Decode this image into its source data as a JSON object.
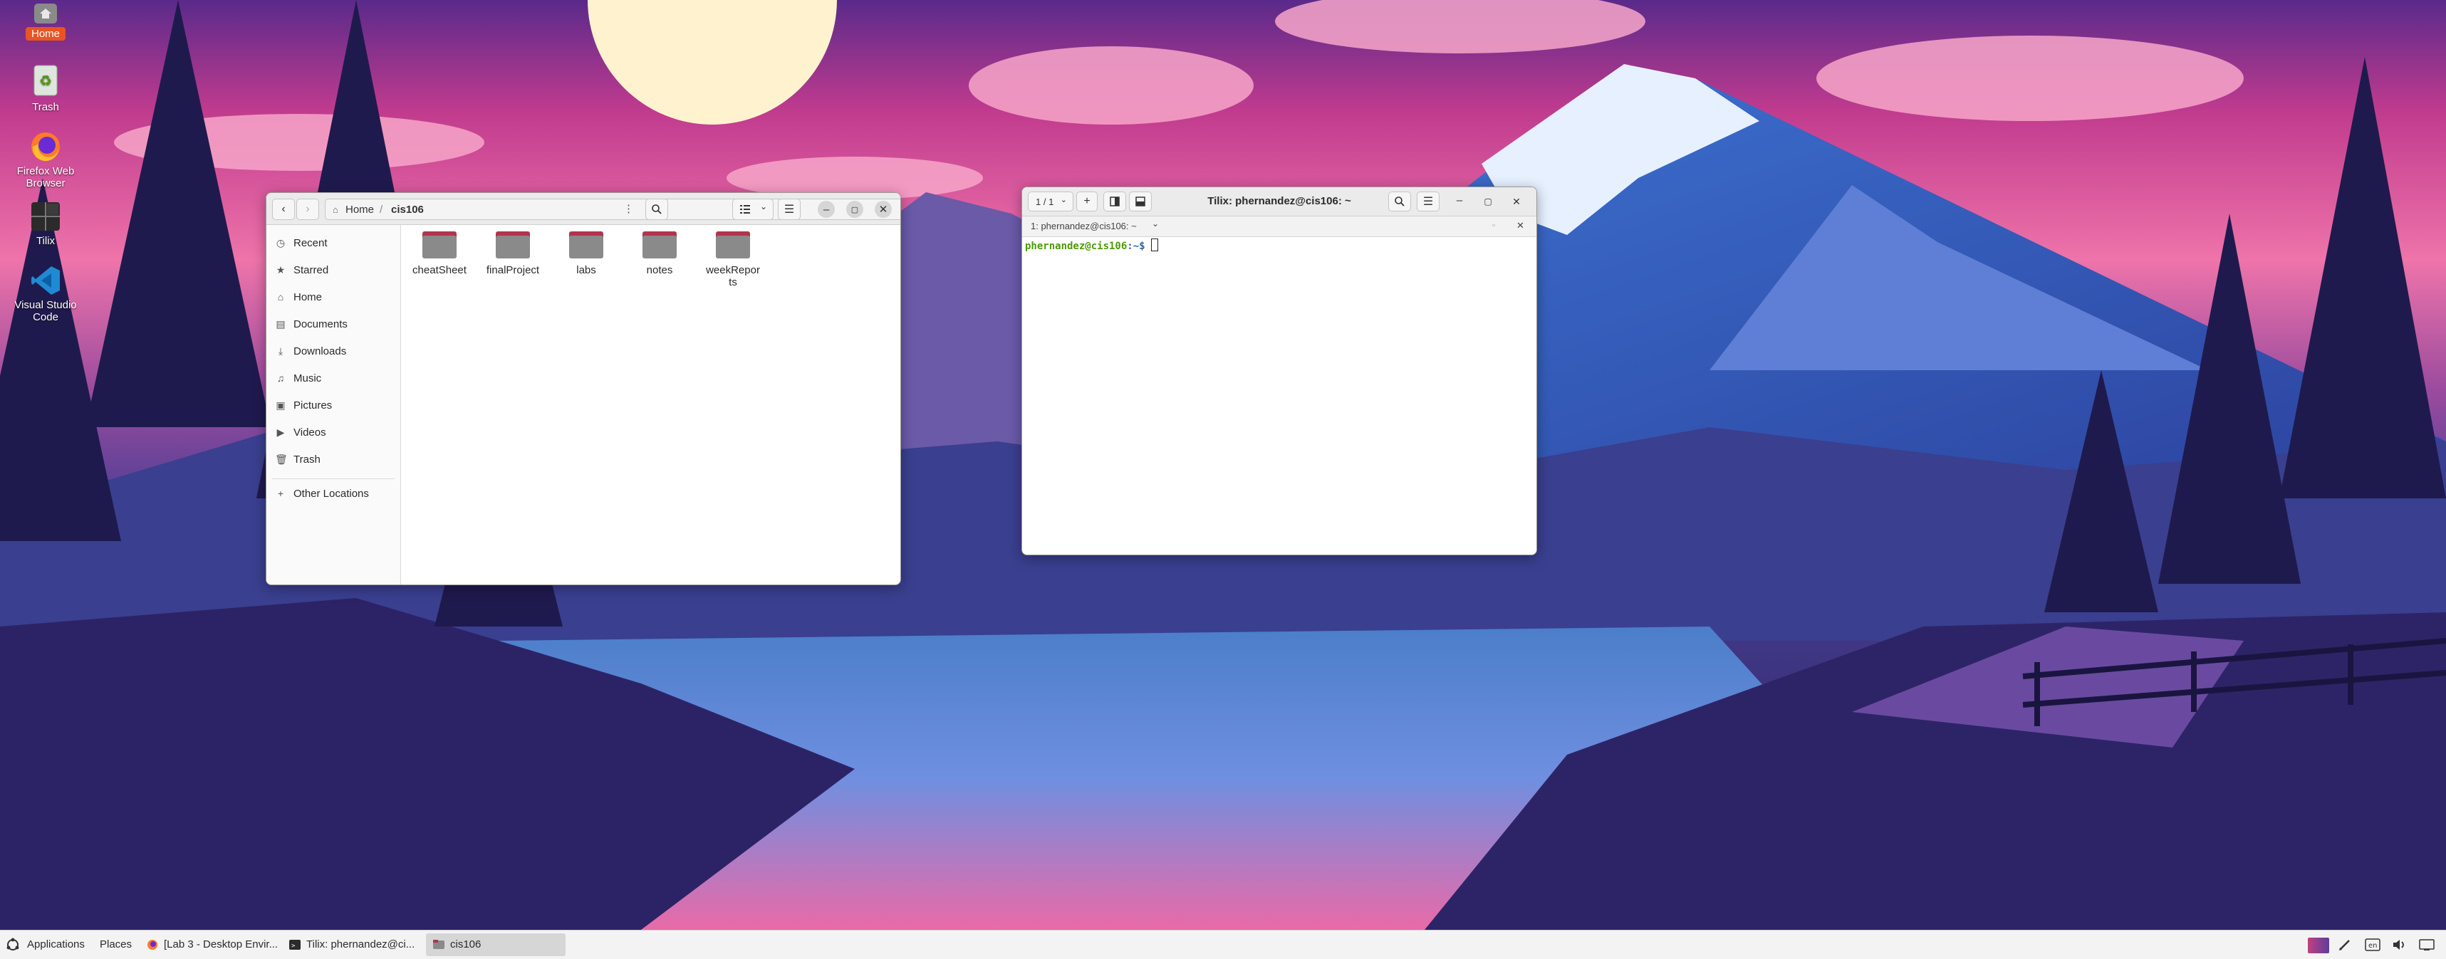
{
  "desktop": {
    "icons": [
      {
        "label": "Home"
      },
      {
        "label": "Trash"
      },
      {
        "label": "Firefox Web Browser"
      },
      {
        "label": "Tilix"
      },
      {
        "label": "Visual Studio Code"
      }
    ]
  },
  "file_manager": {
    "breadcrumb": [
      "Home",
      "cis106"
    ],
    "sidebar": {
      "items": [
        {
          "label": "Recent",
          "icon": "clock-icon"
        },
        {
          "label": "Starred",
          "icon": "star-icon"
        },
        {
          "label": "Home",
          "icon": "home-icon"
        },
        {
          "label": "Documents",
          "icon": "document-icon"
        },
        {
          "label": "Downloads",
          "icon": "download-icon"
        },
        {
          "label": "Music",
          "icon": "music-icon"
        },
        {
          "label": "Pictures",
          "icon": "picture-icon"
        },
        {
          "label": "Videos",
          "icon": "video-icon"
        },
        {
          "label": "Trash",
          "icon": "trash-icon"
        }
      ],
      "other_locations": "Other Locations"
    },
    "folders": [
      {
        "name": "cheatSheet"
      },
      {
        "name": "finalProject"
      },
      {
        "name": "labs"
      },
      {
        "name": "notes"
      },
      {
        "name": "weekRepor ts"
      }
    ]
  },
  "terminal": {
    "session_counter": "1 / 1",
    "title": "Tilix: phernandez@cis106: ~",
    "tab_title": "1: phernandez@cis106: ~",
    "prompt_user_host": "phernandez@cis106",
    "prompt_path": ":~$",
    "colors": {
      "prompt_user": "#4e9a06",
      "prompt_path": "#3465a4"
    }
  },
  "taskbar": {
    "applications_label": "Applications",
    "places_label": "Places",
    "tasks": [
      {
        "label": "[Lab 3 - Desktop Envir...",
        "icon": "firefox-icon"
      },
      {
        "label": "Tilix: phernandez@ci...",
        "icon": "terminal-icon"
      },
      {
        "label": "cis106",
        "icon": "folder-icon",
        "active": true
      }
    ]
  },
  "colors": {
    "accent": "#e95420",
    "folder": "#8a8a8a",
    "folder_tab": "#b2344f"
  }
}
